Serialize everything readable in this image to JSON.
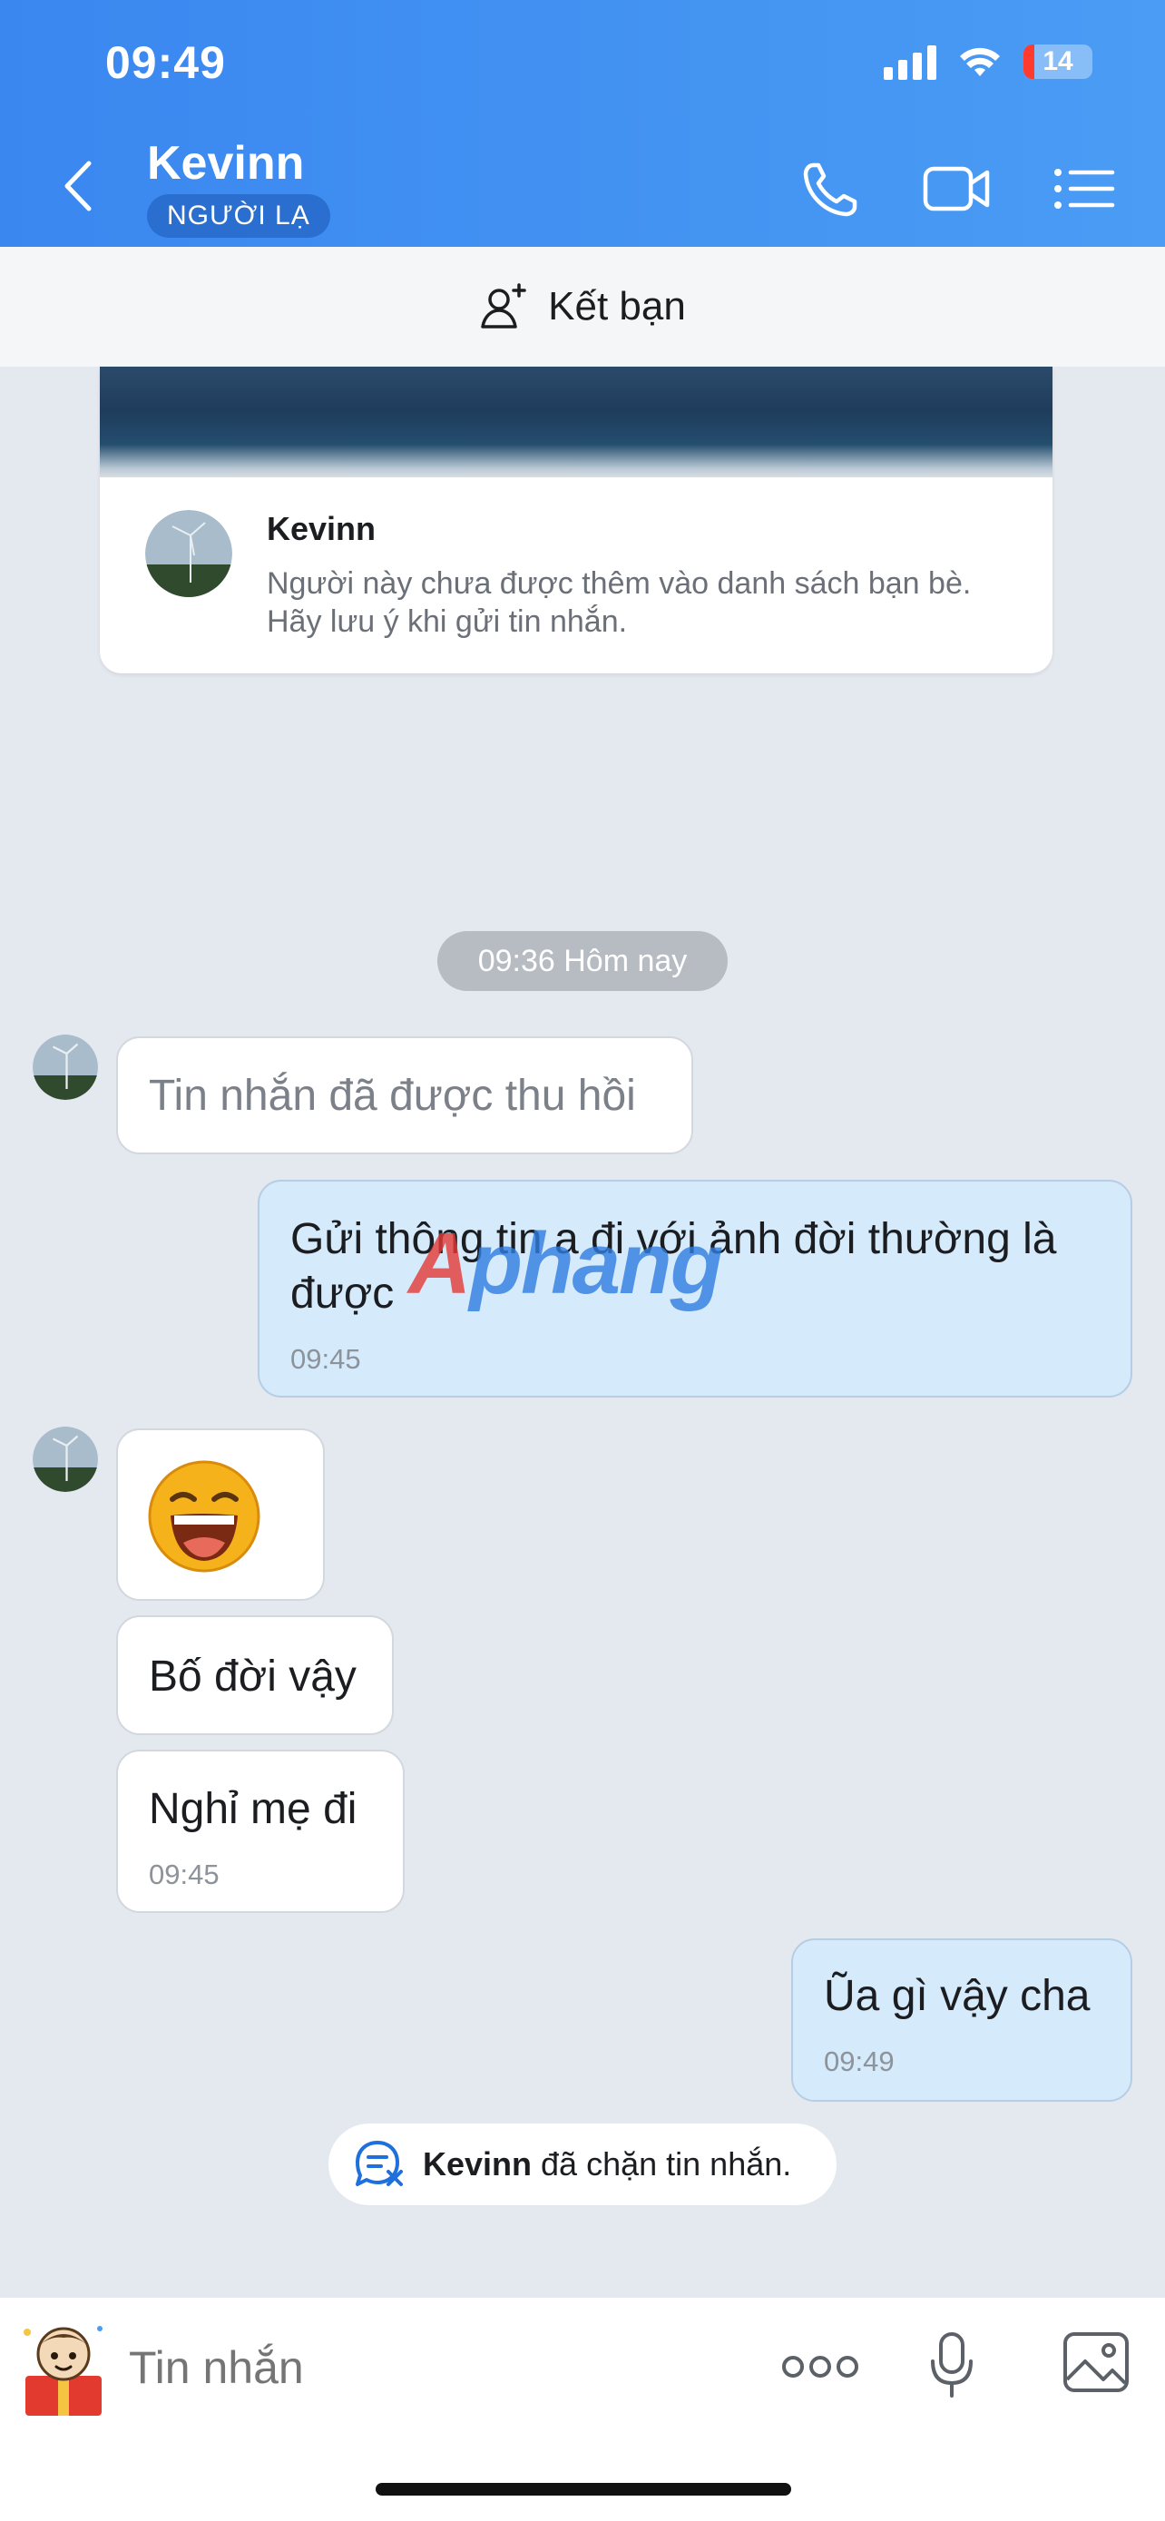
{
  "status_bar": {
    "time": "09:49",
    "battery": "14"
  },
  "header": {
    "name": "Kevinn",
    "badge": "NGƯỜI LẠ"
  },
  "add_friend": {
    "label": "Kết bạn"
  },
  "profile_card": {
    "name": "Kevinn",
    "description": "Người này chưa được thêm vào danh sách bạn bè. Hãy lưu ý khi gửi tin nhắn."
  },
  "date_separator": "09:36 Hôm nay",
  "messages": [
    {
      "text": "Tin nhắn đã được thu hồi"
    },
    {
      "text": "Gửi thông tin a đi với ảnh đời thường là được",
      "time": "09:45"
    },
    {
      "emoji": "laughing-sticker"
    },
    {
      "text": "Bố đời vậy"
    },
    {
      "text": "Nghỉ mẹ đi",
      "time": "09:45"
    },
    {
      "text": "Ũa gì vậy cha",
      "time": "09:49"
    }
  ],
  "watermark": {
    "part1": "A",
    "part2": "phang"
  },
  "blocked_notice": {
    "name": "Kevinn",
    "text": " đã chặn tin nhắn."
  },
  "composer": {
    "placeholder": "Tin nhắn"
  },
  "colors": {
    "header": "#3a87f0",
    "mine_bubble": "#d5eafb",
    "badge": "#2a6fd0"
  }
}
